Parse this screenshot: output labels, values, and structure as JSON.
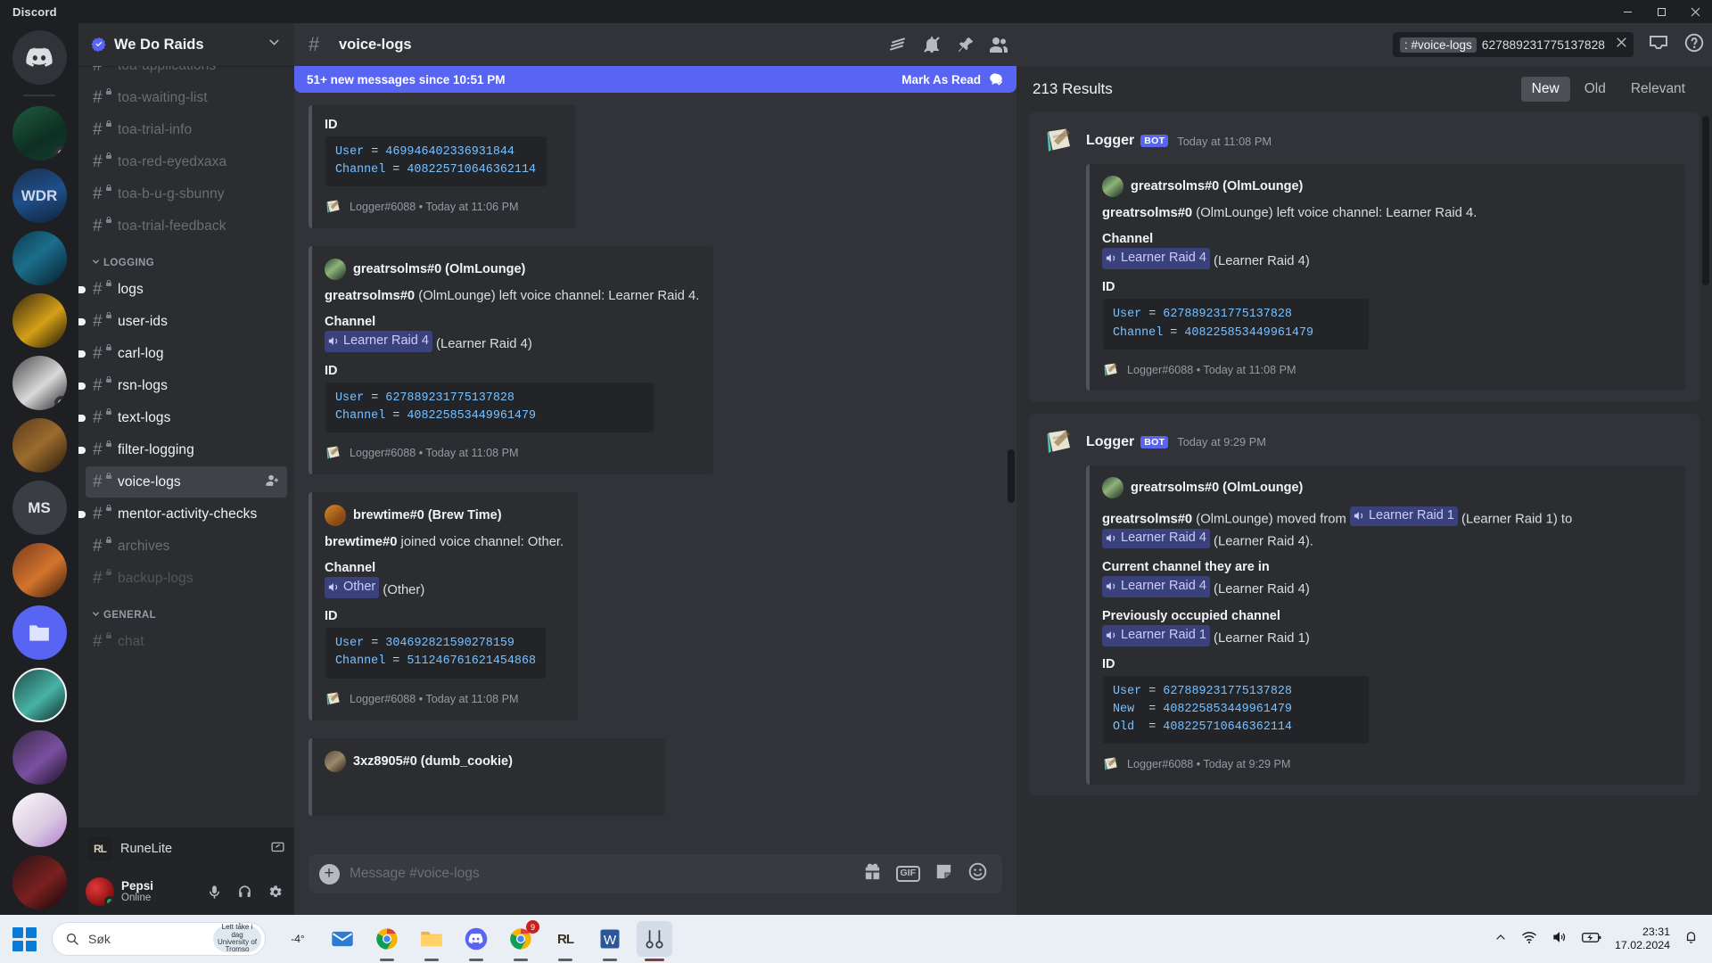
{
  "window": {
    "title": "Discord",
    "minimize": "─",
    "maximize": "☐",
    "close": "✕"
  },
  "guild": {
    "name": "We Do Raids",
    "chevron_icon": "chevron-down-icon"
  },
  "sidebar": {
    "channels_top": [
      {
        "name": "toa-applications",
        "state": "muted",
        "clipped": true
      },
      {
        "name": "toa-waiting-list",
        "state": "muted"
      },
      {
        "name": "toa-trial-info",
        "state": "muted"
      },
      {
        "name": "toa-red-eyedxaxa",
        "state": "muted"
      },
      {
        "name": "toa-b-u-g-sbunny",
        "state": "muted"
      },
      {
        "name": "toa-trial-feedback",
        "state": "muted"
      }
    ],
    "categories": [
      {
        "label": "LOGGING",
        "channels": [
          {
            "name": "logs",
            "state": "unread"
          },
          {
            "name": "user-ids",
            "state": "unread"
          },
          {
            "name": "carl-log",
            "state": "unread"
          },
          {
            "name": "rsn-logs",
            "state": "unread"
          },
          {
            "name": "text-logs",
            "state": "unread"
          },
          {
            "name": "filter-logging",
            "state": "unread"
          },
          {
            "name": "voice-logs",
            "state": "active",
            "tail_icon": "add-member-icon"
          },
          {
            "name": "mentor-activity-checks",
            "state": "unread"
          },
          {
            "name": "archives",
            "state": "muted"
          },
          {
            "name": "backup-logs",
            "state": "dim"
          }
        ]
      },
      {
        "label": "GENERAL",
        "channels": [
          {
            "name": "chat",
            "state": "dim"
          }
        ]
      }
    ],
    "activity": {
      "logo_text": "RL",
      "name": "RuneLite",
      "action_icon": "popout-icon"
    },
    "user": {
      "name": "Pepsi",
      "status": "Online",
      "buttons": [
        {
          "icon": "microphone-icon"
        },
        {
          "icon": "headphones-icon"
        },
        {
          "icon": "gear-icon"
        }
      ]
    }
  },
  "chat": {
    "channel_name": "voice-logs",
    "header_icons": [
      "threads-icon",
      "notification-off-icon",
      "pin-icon",
      "members-icon"
    ],
    "new_messages_banner": {
      "text": "51+ new messages since 10:51 PM",
      "action": "Mark As Read",
      "action_icon": "mark-read-icon"
    },
    "messages": [
      {
        "partial_top": true,
        "author": "",
        "description": "",
        "fields": [
          {
            "name": "ID",
            "value": ""
          }
        ],
        "code": [
          {
            "key": "User",
            "value": "469946402336931844"
          },
          {
            "key": "Channel",
            "value": "408225710646362114"
          }
        ],
        "footer": "Logger#6088 • Today at 11:06 PM"
      },
      {
        "author": "greatrsolms#0 (OlmLounge)",
        "desc_bold": "greatrsolms#0",
        "desc_rest": " (OlmLounge) left voice channel: Learner Raid 4.",
        "channel_field_label": "Channel",
        "channel_mention": "Learner Raid 4",
        "channel_paren": "(Learner Raid 4)",
        "id_label": "ID",
        "code": [
          {
            "key": "User",
            "value": "627889231775137828"
          },
          {
            "key": "Channel",
            "value": "408225853449961479"
          }
        ],
        "footer": "Logger#6088 • Today at 11:08 PM"
      },
      {
        "author": "brewtime#0 (Brew Time)",
        "desc_bold": "brewtime#0",
        "desc_rest": " joined voice channel: Other.",
        "channel_field_label": "Channel",
        "channel_mention": "Other",
        "channel_paren": "(Other)",
        "id_label": "ID",
        "code": [
          {
            "key": "User",
            "value": "304692821590278159"
          },
          {
            "key": "Channel",
            "value": "511246761621454868"
          }
        ],
        "footer": "Logger#6088 • Today at 11:08 PM"
      },
      {
        "author": "3xz8905#0 (dumb_cookie)",
        "partial_bottom": true
      }
    ],
    "composer": {
      "placeholder": "Message #voice-logs",
      "icons": [
        "gift-icon",
        "gif-icon",
        "sticker-icon",
        "emoji-icon"
      ],
      "gif_label": "GIF"
    }
  },
  "search": {
    "query_chip": ": #voice-logs",
    "query_text": "627889231775137828",
    "clear_icon": "close-icon",
    "inbox_icon": "inbox-icon",
    "help_icon": "help-icon",
    "results_count": "213 Results",
    "sort_tabs": [
      {
        "label": "New",
        "active": true
      },
      {
        "label": "Old",
        "active": false
      },
      {
        "label": "Relevant",
        "active": false
      }
    ],
    "results": [
      {
        "bot_name": "Logger",
        "bot_tag": "BOT",
        "timestamp": "Today at 11:08 PM",
        "author": "greatrsolms#0 (OlmLounge)",
        "desc_bold": "greatrsolms#0",
        "desc_rest": " (OlmLounge) left voice channel: Learner Raid 4.",
        "fields": [
          {
            "label": "Channel",
            "mention": "Learner Raid 4",
            "paren": "(Learner Raid 4)"
          }
        ],
        "id_label": "ID",
        "code": [
          {
            "key": "User",
            "value": "627889231775137828"
          },
          {
            "key": "Channel",
            "value": "408225853449961479"
          }
        ],
        "footer": "Logger#6088 • Today at 11:08 PM"
      },
      {
        "bot_name": "Logger",
        "bot_tag": "BOT",
        "timestamp": "Today at 9:29 PM",
        "author": "greatrsolms#0 (OlmLounge)",
        "desc_bold": "greatrsolms#0",
        "desc_rest": " (OlmLounge) moved from ",
        "moved_from_mention": "Learner Raid 1",
        "moved_from_paren": "(Learner Raid 1) to",
        "moved_to_mention": "Learner Raid 4",
        "moved_to_paren": "(Learner Raid 4).",
        "fields": [
          {
            "label": "Current channel they are in",
            "mention": "Learner Raid 4",
            "paren": "(Learner Raid 4)"
          },
          {
            "label": "Previously occupied channel",
            "mention": "Learner Raid 1",
            "paren": "(Learner Raid 1)"
          }
        ],
        "id_label": "ID",
        "code": [
          {
            "key": "User",
            "value": "627889231775137828"
          },
          {
            "key": "New",
            "value": "408225853449961479"
          },
          {
            "key": "Old",
            "value": "408225710646362114"
          }
        ],
        "footer": "Logger#6088 • Today at 9:29 PM"
      }
    ]
  },
  "taskbar": {
    "search_placeholder": "Søk",
    "weather_chip_line1": "Lett tåke i dag",
    "weather_chip_line2": "University of Tromso",
    "temperature": "-4°",
    "apps": [
      {
        "icon": "mail-icon",
        "running": false
      },
      {
        "icon": "chrome-icon",
        "running": true
      },
      {
        "icon": "file-explorer-icon",
        "running": true
      },
      {
        "icon": "discord-icon",
        "running": true
      },
      {
        "icon": "chrome-badge-icon",
        "running": true,
        "badge": "9"
      },
      {
        "icon": "runelite-icon",
        "running": true
      },
      {
        "icon": "word-icon",
        "running": true
      },
      {
        "icon": "snip-icon",
        "running": true,
        "selected": true
      }
    ],
    "tray": [
      "chevron-up-icon",
      "wifi-icon",
      "volume-icon",
      "battery-icon"
    ],
    "clock_time": "23:31",
    "clock_date": "17.02.2024",
    "notification_icon": "bell-icon"
  },
  "colors": {
    "brand": "#5865f2",
    "sidebar_bg": "#2b2d31",
    "chat_bg": "#313338",
    "rail_bg": "#1e1f22",
    "mention_bg": "rgba(88,101,242,.38)"
  }
}
